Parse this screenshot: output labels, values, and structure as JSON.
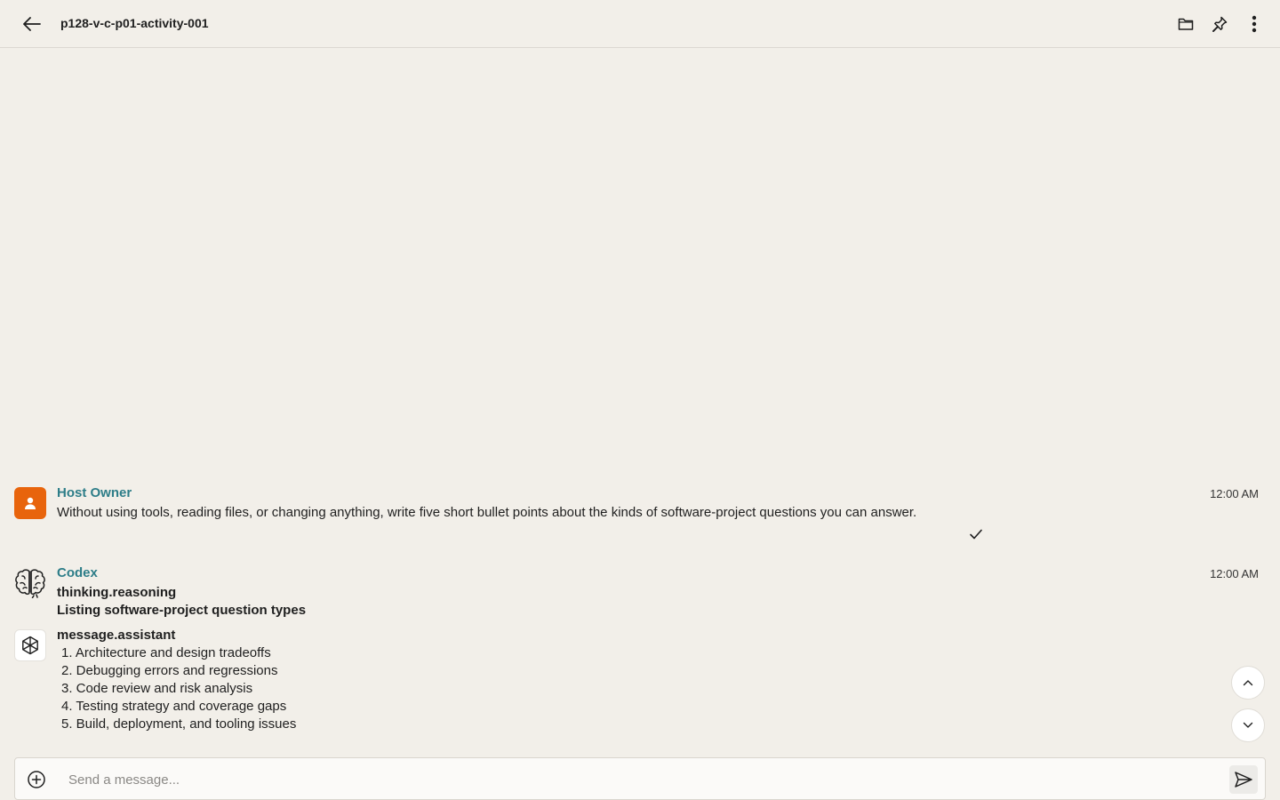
{
  "header": {
    "title": "p128-v-c-p01-activity-001",
    "back_icon": "arrow-left-icon",
    "folder_icon": "folder-icon",
    "pin_icon": "pin-icon",
    "more_icon": "more-vertical-icon"
  },
  "messages": [
    {
      "sender": "Host Owner",
      "time": "12:00 AM",
      "text": "Without using tools, reading files, or changing anything, write five short bullet points about the kinds of software-project questions you can answer.",
      "avatar_icon": "person-icon",
      "status_icon": "check-icon"
    },
    {
      "sender": "Codex",
      "time": "12:00 AM",
      "avatar_icon": "brain-icon",
      "thinking_label": "thinking.reasoning",
      "thinking_text": "Listing software-project question types",
      "assistant_avatar_icon": "openai-logo-icon",
      "assistant_label": "message.assistant",
      "items": [
        "1. Architecture and design tradeoffs",
        "2. Debugging errors and regressions",
        "3. Code review and risk analysis",
        "4. Testing strategy and coverage gaps",
        "5. Build, deployment, and tooling issues"
      ]
    }
  ],
  "composer": {
    "placeholder": "Send a message...",
    "value": "",
    "attach_icon": "plus-circle-icon",
    "send_icon": "send-icon"
  },
  "scroll": {
    "up_icon": "chevron-up-icon",
    "down_icon": "chevron-down-icon"
  },
  "colors": {
    "background": "#f2efe9",
    "sender_name": "#2d7d88",
    "owner_avatar": "#e8640c"
  }
}
